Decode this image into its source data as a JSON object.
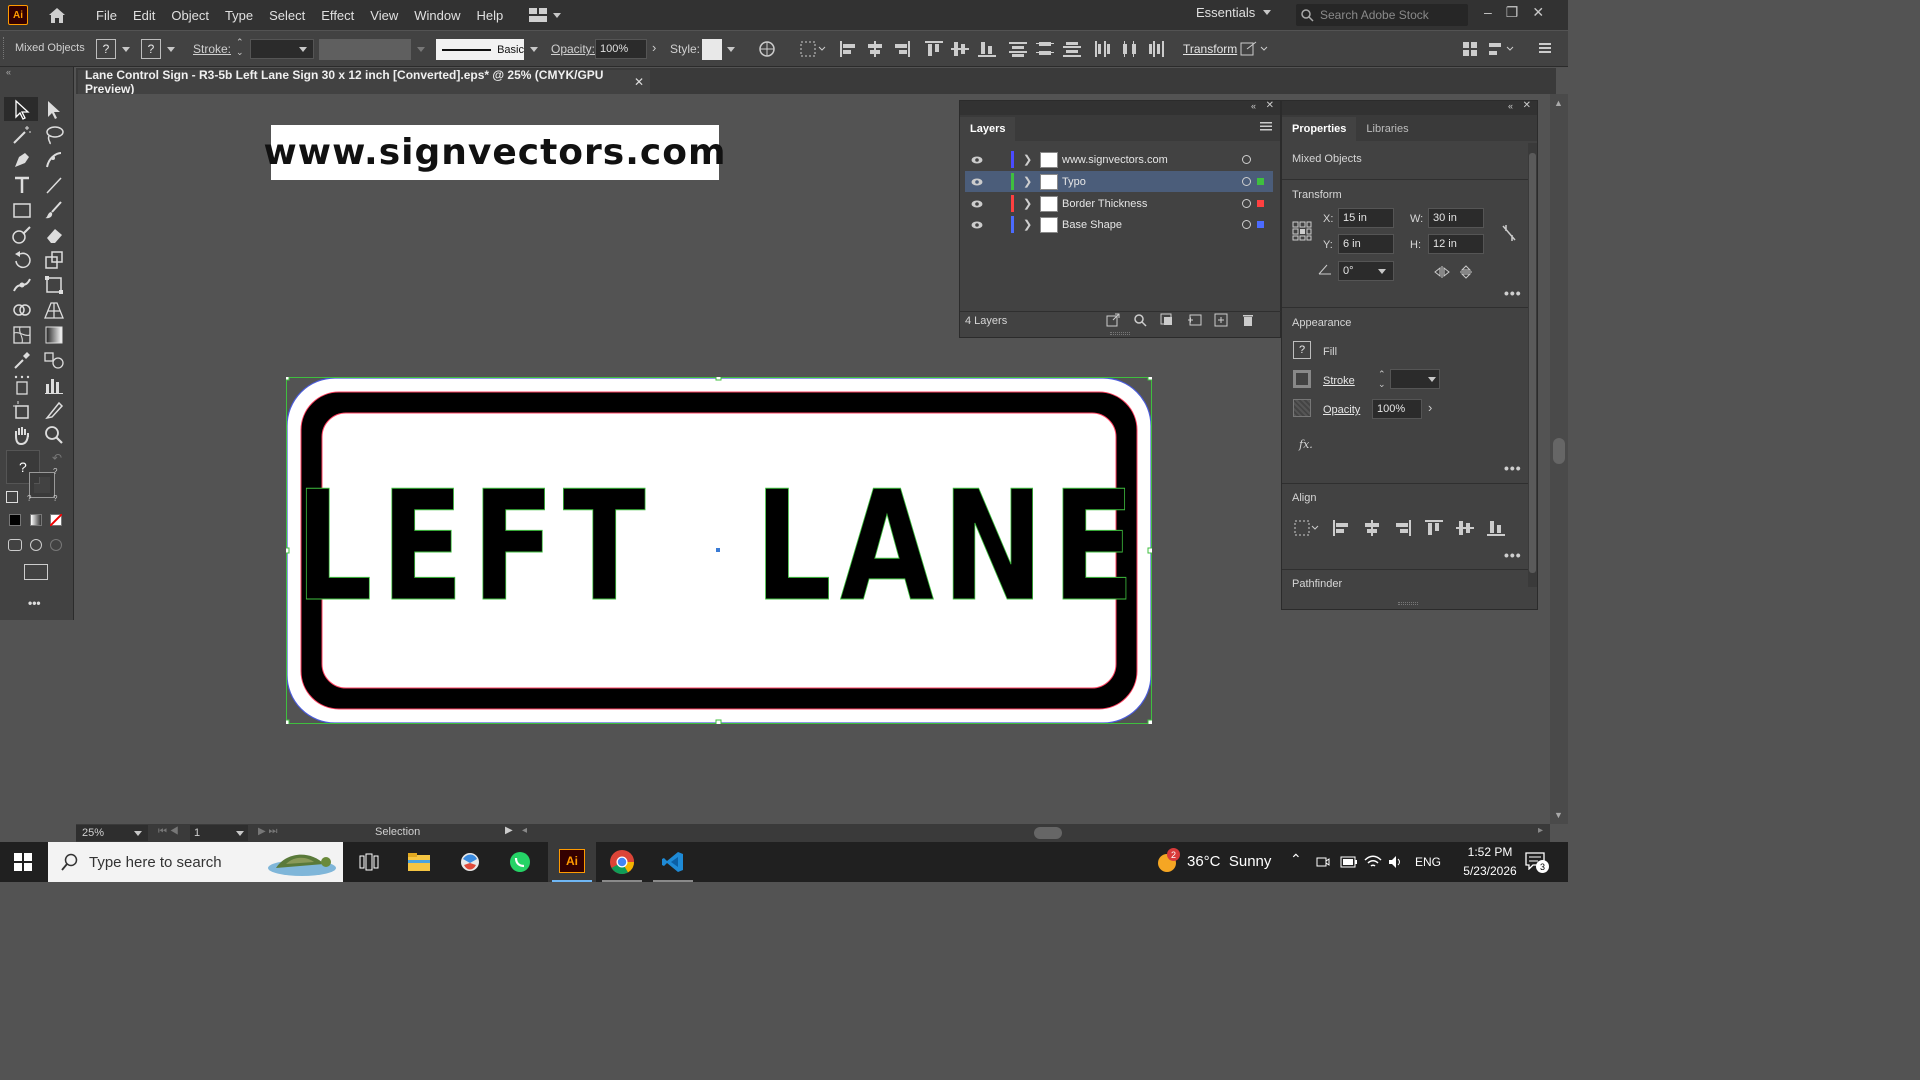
{
  "app": {
    "logo_text": "Ai",
    "menus": [
      "File",
      "Edit",
      "Object",
      "Type",
      "Select",
      "Effect",
      "View",
      "Window",
      "Help"
    ],
    "workspace": "Essentials",
    "search_placeholder": "Search Adobe Stock"
  },
  "control_bar": {
    "selection_type": "Mixed Objects",
    "fill_value": "?",
    "stroke_color_value": "?",
    "stroke_label": "Stroke:",
    "brush_label": "Basic",
    "opacity_label": "Opacity:",
    "opacity_value": "100%",
    "style_label": "Style:",
    "transform_label": "Transform"
  },
  "document": {
    "tab_title": "Lane Control Sign - R3-5b Left Lane Sign 30 x 12 inch  [Converted].eps* @ 25% (CMYK/GPU Preview)",
    "close_glyph": "✕"
  },
  "artwork": {
    "watermark": "www.signvectors.com",
    "sign_text": "LEFT  LANE"
  },
  "layers_panel": {
    "tab": "Layers",
    "layers": [
      {
        "name": "www.signvectors.com",
        "color": "#4b4bff",
        "selected": false
      },
      {
        "name": "Typo",
        "color": "#3fbf3f",
        "selected": true
      },
      {
        "name": "Border Thickness",
        "color": "#ff4040",
        "selected": false
      },
      {
        "name": "Base Shape",
        "color": "#4b6bff",
        "selected": false
      }
    ],
    "count_label": "4 Layers"
  },
  "properties_panel": {
    "tabs": [
      "Properties",
      "Libraries"
    ],
    "selection_type": "Mixed Objects",
    "transform": {
      "heading": "Transform",
      "x_label": "X:",
      "x_value": "15 in",
      "y_label": "Y:",
      "y_value": "6 in",
      "w_label": "W:",
      "w_value": "30 in",
      "h_label": "H:",
      "h_value": "12 in",
      "angle_value": "0°"
    },
    "appearance": {
      "heading": "Appearance",
      "fill_label": "Fill",
      "fill_value": "?",
      "stroke_label": "Stroke",
      "opacity_label": "Opacity",
      "opacity_value": "100%",
      "fx_label": "fx."
    },
    "align_heading": "Align",
    "pathfinder_heading": "Pathfinder"
  },
  "toolbar": {
    "fill_stroke_value": "?",
    "more_label": "•••"
  },
  "status_bar": {
    "zoom": "25%",
    "artboard": "1",
    "tool": "Selection"
  },
  "taskbar": {
    "search_text": "Type here to search",
    "weather_badge": "2",
    "weather": "36°C  Sunny",
    "language": "ENG",
    "time": "1:52 PM",
    "date": "5/23/2026",
    "notifications": "3"
  }
}
